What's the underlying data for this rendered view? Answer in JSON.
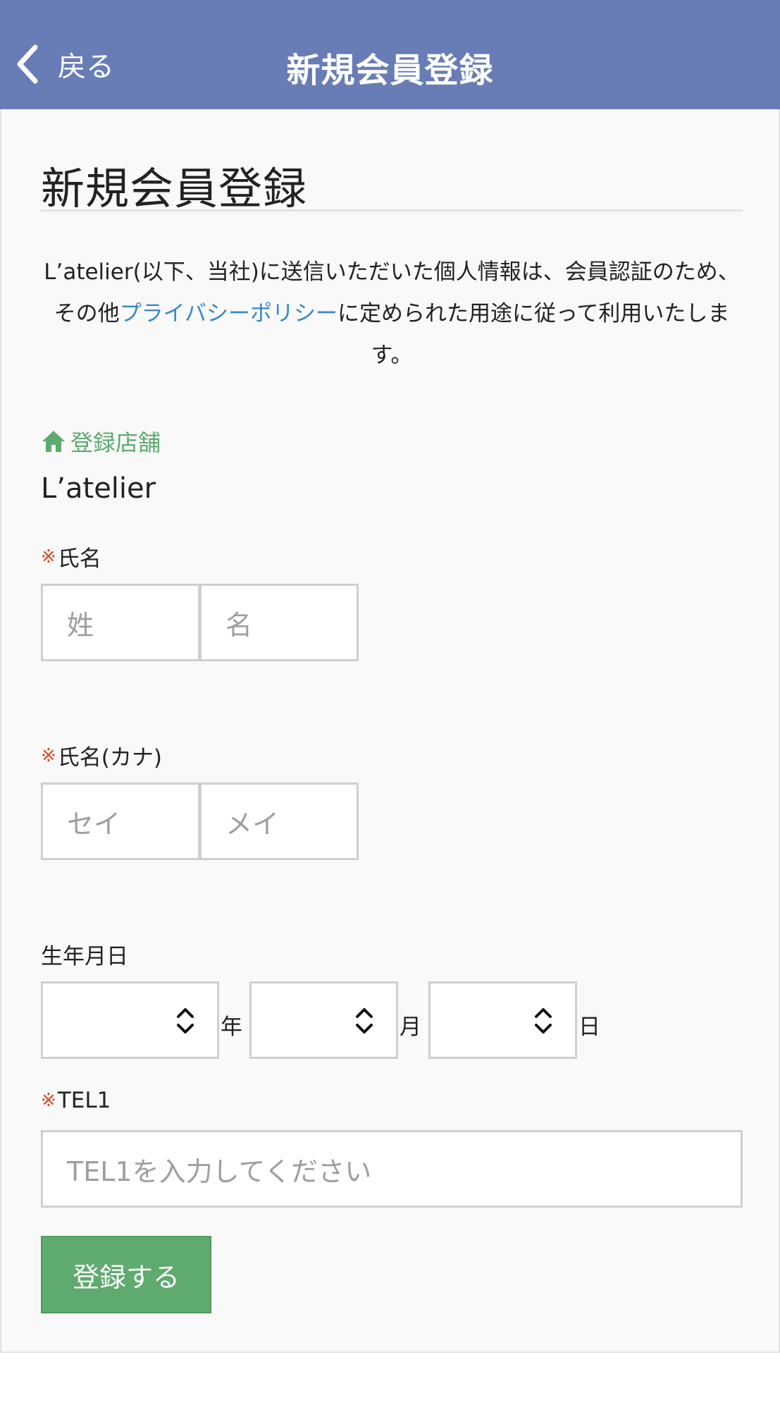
{
  "header": {
    "back_label": "戻る",
    "title": "新規会員登録"
  },
  "page": {
    "title": "新規会員登録",
    "notice_before": "L’atelier(以下、当社)に送信いただいた個人情報は、会員認証のため、その他",
    "notice_link": "プライバシーポリシー",
    "notice_after": "に定められた用途に従って利用いたします。"
  },
  "store": {
    "label": "登録店舗",
    "name": "L’atelier"
  },
  "form": {
    "required_mark": "※",
    "name": {
      "label": "氏名",
      "last_placeholder": "姓",
      "first_placeholder": "名"
    },
    "kana": {
      "label": "氏名(カナ)",
      "last_placeholder": "セイ",
      "first_placeholder": "メイ"
    },
    "birthday": {
      "label": "生年月日",
      "year_unit": "年",
      "month_unit": "月",
      "day_unit": "日"
    },
    "tel": {
      "label": "TEL1",
      "placeholder": "TEL1を入力してください"
    },
    "submit_label": "登録する"
  },
  "colors": {
    "header_bg": "#687db5",
    "link": "#3a8ac2",
    "accent_green": "#5faa6f",
    "required": "#d04a2a"
  },
  "icons": {
    "back": "chevron-left-icon",
    "store": "home-icon",
    "select": "up-down-chevron-icon"
  }
}
